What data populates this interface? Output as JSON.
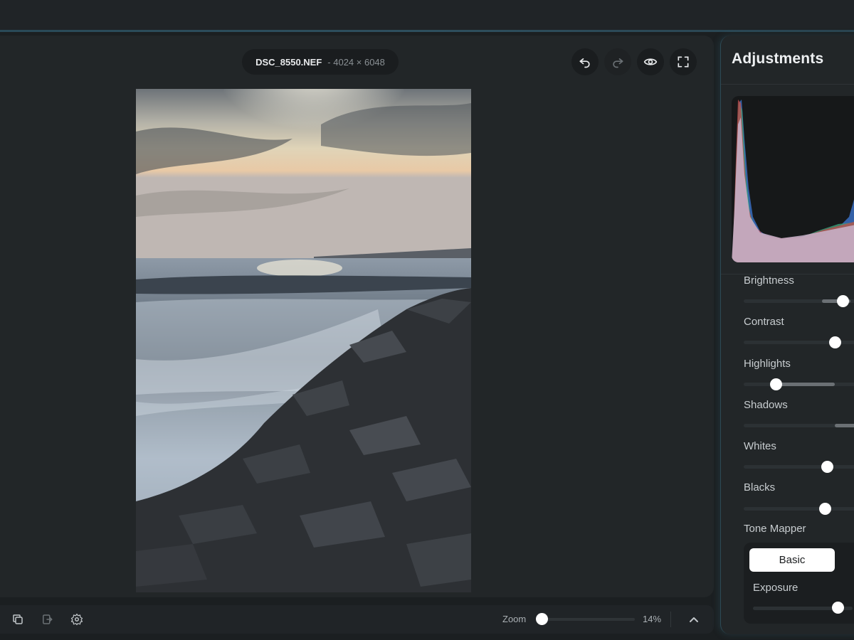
{
  "file": {
    "name": "DSC_8550.NEF",
    "dims": "- 4024 × 6048"
  },
  "toolbar": {
    "undo_icon": "undo-icon",
    "redo_icon": "redo-icon",
    "preview_icon": "eye-icon",
    "fullscreen_icon": "fullscreen-icon"
  },
  "bottom": {
    "icons": [
      "copy-icon",
      "paste-icon",
      "gear-icon"
    ],
    "zoom_label": "Zoom",
    "zoom_percent": "14%",
    "zoom_level": 0.14
  },
  "panel": {
    "title": "Adjustments",
    "sliders": [
      {
        "label": "Brightness"
      },
      {
        "label": "Contrast"
      },
      {
        "label": "Highlights"
      },
      {
        "label": "Shadows"
      },
      {
        "label": "Whites"
      },
      {
        "label": "Blacks"
      }
    ],
    "tone_mapper": {
      "label": "Tone Mapper",
      "selected": "Basic",
      "exposure_label": "Exposure"
    }
  },
  "colors": {
    "accent": "#2e4f5e",
    "background": "#1b1f21",
    "panel": "#222628"
  }
}
